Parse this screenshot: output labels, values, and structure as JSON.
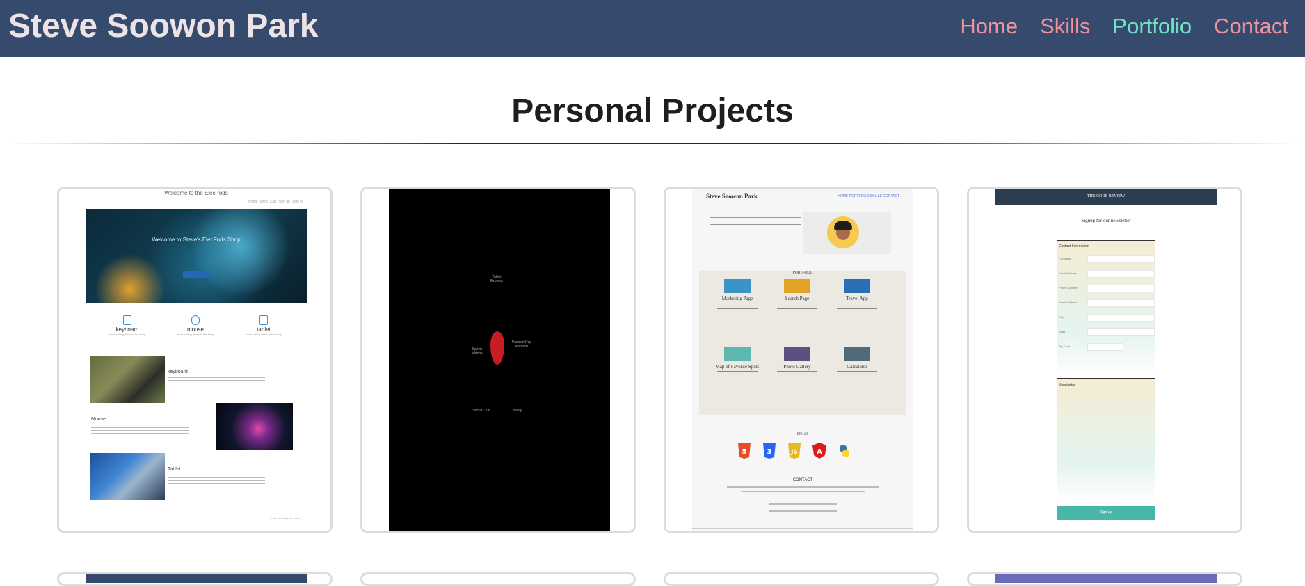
{
  "nav": {
    "brand": "Steve Soowon Park",
    "links": [
      "Home",
      "Skills",
      "Portfolio",
      "Contact"
    ],
    "active": "Portfolio"
  },
  "section": {
    "title": "Personal Projects"
  },
  "colors": {
    "navbar": "#364a6e",
    "nav_link": "#f0939f",
    "nav_link_active": "#6fe3c4",
    "card_border": "#dcdcdc"
  },
  "cards": [
    {
      "kind": "elecpods",
      "title": "Welcome to the ElecPods",
      "hero_text": "Welcome to Steve's ElecPods Shop",
      "features": [
        "keyboard",
        "mouse",
        "tablet"
      ],
      "rows": [
        "keyboard",
        "Mouse",
        "Tablet"
      ]
    },
    {
      "kind": "heart",
      "labels": [
        "Tablet Express",
        "Sports Videos",
        "Passion Pop Nomads",
        "Social Club",
        "Chasity"
      ]
    },
    {
      "kind": "portfolio",
      "name": "Steve Soowon Park",
      "nav": "HOME   PORTFOLIO   SKILLS   CONTACT",
      "portfolio_label": "PORTFOLIO",
      "tiles": [
        "Marketing Page",
        "Search Page",
        "Travel App",
        "Map of Favorite Spots",
        "Photo Gallery",
        "Calculator"
      ],
      "skills_label": "SKILLS",
      "contact_label": "CONTACT"
    },
    {
      "kind": "newsletter",
      "bar_title": "THE CODE REVIEW",
      "heading": "Signup for our newsletter",
      "section1": "Contact Information",
      "fields": [
        "Full Name",
        "Email Address",
        "Phone Number",
        "Street Address",
        "City",
        "State",
        "Zip Code"
      ],
      "section2": "Newsletter",
      "button": "Sign Up"
    }
  ]
}
